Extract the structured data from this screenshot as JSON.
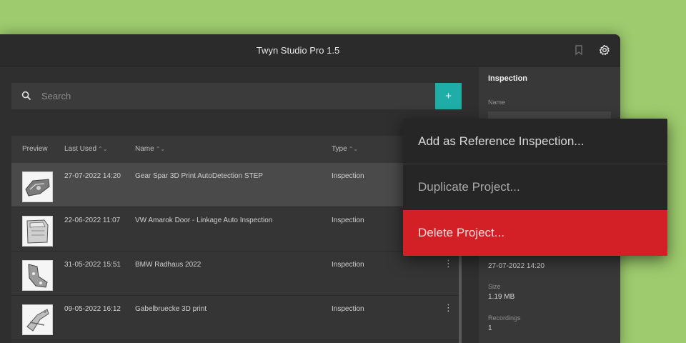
{
  "app": {
    "title": "Twyn Studio Pro 1.5",
    "icons": {
      "library": "bookmark-icon",
      "settings": "gear-icon"
    }
  },
  "search": {
    "placeholder": "Search",
    "add_label": "+"
  },
  "table": {
    "columns": {
      "preview": "Preview",
      "last_used": "Last Used",
      "name": "Name",
      "type": "Type",
      "sort_glyph": "⌃⌄"
    },
    "rows": [
      {
        "date": "27-07-2022 14:20",
        "name": "Gear Spar 3D Print AutoDetection STEP",
        "type": "Inspection",
        "selected": true
      },
      {
        "date": "22-06-2022 11:07",
        "name": "VW Amarok Door - Linkage Auto Inspection",
        "type": "Inspection",
        "selected": false
      },
      {
        "date": "31-05-2022 15:51",
        "name": "BMW Radhaus 2022",
        "type": "Inspection",
        "selected": false
      },
      {
        "date": "09-05-2022 16:12",
        "name": "Gabelbruecke 3D print",
        "type": "Inspection",
        "selected": false
      }
    ],
    "kebab": "⋮"
  },
  "inspection_panel": {
    "heading": "Inspection",
    "name_label": "Name",
    "date_value": "27-07-2022 14:20",
    "size_label": "Size",
    "size_value": "1.19 MB",
    "recordings_label": "Recordings",
    "recordings_value": "1"
  },
  "context_menu": {
    "items": [
      {
        "label": "Add as Reference Inspection..."
      },
      {
        "label": "Duplicate Project..."
      },
      {
        "label": "Delete Project..."
      }
    ]
  },
  "colors": {
    "background": "#9dcb6d",
    "accent": "#1eada7",
    "danger": "#d32027"
  }
}
